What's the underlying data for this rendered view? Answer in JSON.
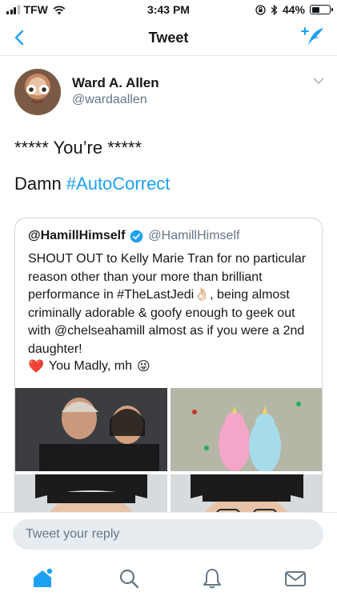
{
  "status_bar": {
    "carrier": "TFW",
    "time": "3:43 PM",
    "battery": "44%",
    "battery_level": 0.44
  },
  "nav": {
    "title": "Tweet"
  },
  "author": {
    "name": "Ward A. Allen",
    "handle": "@wardaallen"
  },
  "tweet": {
    "line1": "***** You’re  *****",
    "line2_text": "Damn ",
    "line2_hashtag": "#AutoCorrect"
  },
  "quoted_tweet": {
    "name": "@HamillHimself",
    "handle": "@HamillHimself",
    "text": "SHOUT OUT to Kelly Marie Tran for no particular reason other than your more than brilliant performance in #TheLastJedi👌🏻, being almost criminally adorable & goofy enough to geek out with @chelseahamill almost as if you were a 2nd daughter!",
    "sign_emoji": "❤️",
    "signoff": "You Madly, mh",
    "sign_emoji_end": "😜"
  },
  "reply": {
    "placeholder": "Tweet your reply"
  },
  "icons": {
    "back": "chevron-left-icon",
    "compose": "compose-tweet-icon",
    "caret": "chevron-down-icon",
    "verified": "verified-badge-icon",
    "home": "home-icon",
    "search": "search-icon",
    "notifications": "bell-icon",
    "messages": "envelope-icon"
  },
  "colors": {
    "accent": "#1da1f2",
    "secondary_text": "#657786",
    "divider": "#e1e8ed"
  }
}
